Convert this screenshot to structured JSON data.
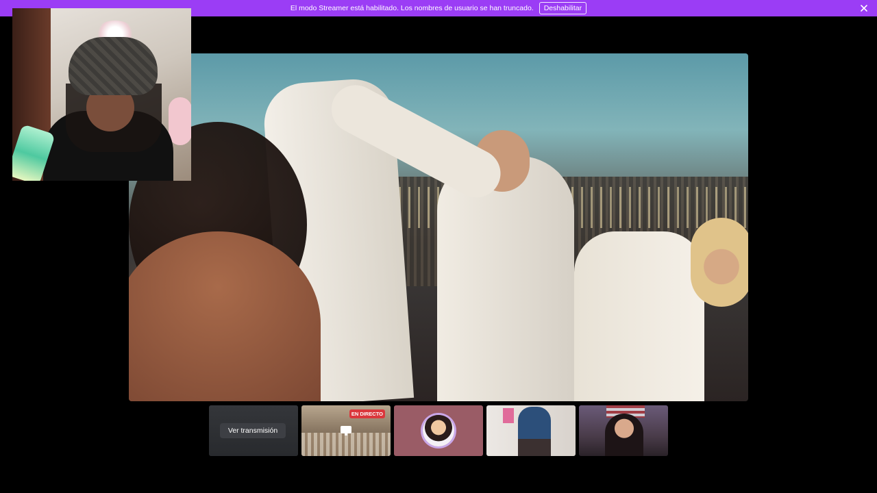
{
  "banner": {
    "message": "El modo Streamer está habilitado. Los nombres de usuario se han truncado.",
    "disable_button": "Deshabilitar",
    "close_icon": "close-icon"
  },
  "thumbnails": [
    {
      "type": "placeholder",
      "button_label": "Ver transmisión"
    },
    {
      "type": "stream",
      "badge": "EN DIRECTO",
      "icon": "screen-share-icon"
    },
    {
      "type": "avatar"
    },
    {
      "type": "camera"
    },
    {
      "type": "camera"
    }
  ],
  "colors": {
    "banner": "#9b3df5",
    "live_badge": "#da373c",
    "background": "#000000"
  }
}
